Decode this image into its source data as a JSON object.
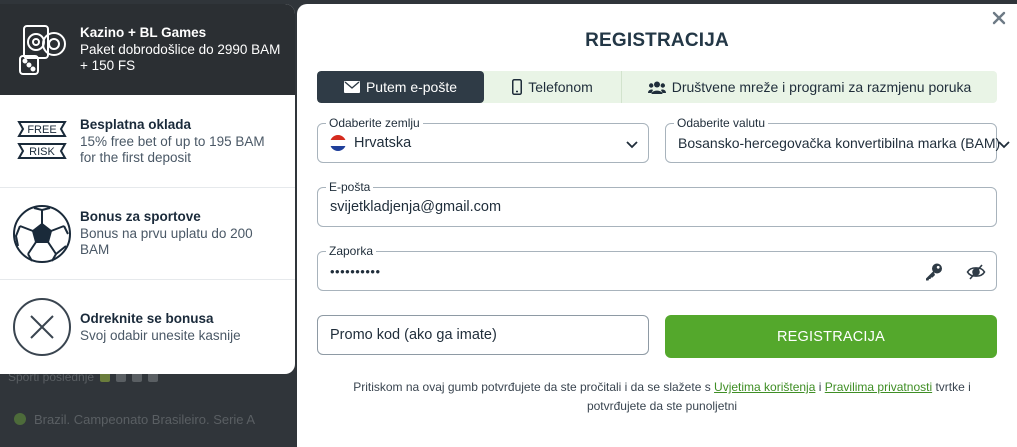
{
  "background": {
    "row1_text": "Sporti poslednje",
    "row2_text": "Brazil. Campeonato Brasileiro. Serie A"
  },
  "bonuses": [
    {
      "title": "Kazino + BL Games",
      "desc": "Paket dobrodošlice do 2990 BAM + 150 FS",
      "icon": "casino-chips-dice-icon",
      "selected": true
    },
    {
      "title": "Besplatna oklada",
      "desc": "15% free bet of up to 195 BAM for the first deposit",
      "icon": "free-risk-icon",
      "icon_text": [
        "FREE",
        "RISK"
      ]
    },
    {
      "title": "Bonus za sportove",
      "desc": "Bonus na prvu uplatu do 200 BAM",
      "icon": "soccer-ball-icon"
    },
    {
      "title": "Odreknite se bonusa",
      "desc": "Svoj odabir unesite kasnije",
      "icon": "close-circle-icon"
    }
  ],
  "modal": {
    "title": "REGISTRACIJA",
    "tabs": [
      {
        "label": "Putem e-pošte",
        "icon": "envelope-icon",
        "active": true
      },
      {
        "label": "Telefonom",
        "icon": "phone-icon"
      },
      {
        "label": "Društvene mreže i programi za razmjenu poruka",
        "icon": "users-icon"
      }
    ],
    "country": {
      "label": "Odaberite zemlju",
      "value": "Hrvatska"
    },
    "currency": {
      "label": "Odaberite valutu",
      "value": "Bosansko-hercegovačka konvertibilna marka (BAM)"
    },
    "email": {
      "label": "E-pošta",
      "value": "svijetkladjenja@gmail.com"
    },
    "password": {
      "label": "Zaporka",
      "value": "••••••••••"
    },
    "promo": {
      "placeholder": "Promo kod (ako ga imate)"
    },
    "register_button": "REGISTRACIJA",
    "terms": {
      "before": "Pritiskom na ovaj gumb potvrđujete da ste pročitali i da se slažete s ",
      "link1": "Uvjetima korištenja",
      "between": " i ",
      "link2": "Pravilima privatnosti",
      "after": " tvrtke i potvrđujete da ste punoljetni"
    }
  },
  "colors": {
    "accent_green": "#54a82c",
    "dark": "#2f3b46",
    "tab_bg": "#e9f4e6"
  }
}
